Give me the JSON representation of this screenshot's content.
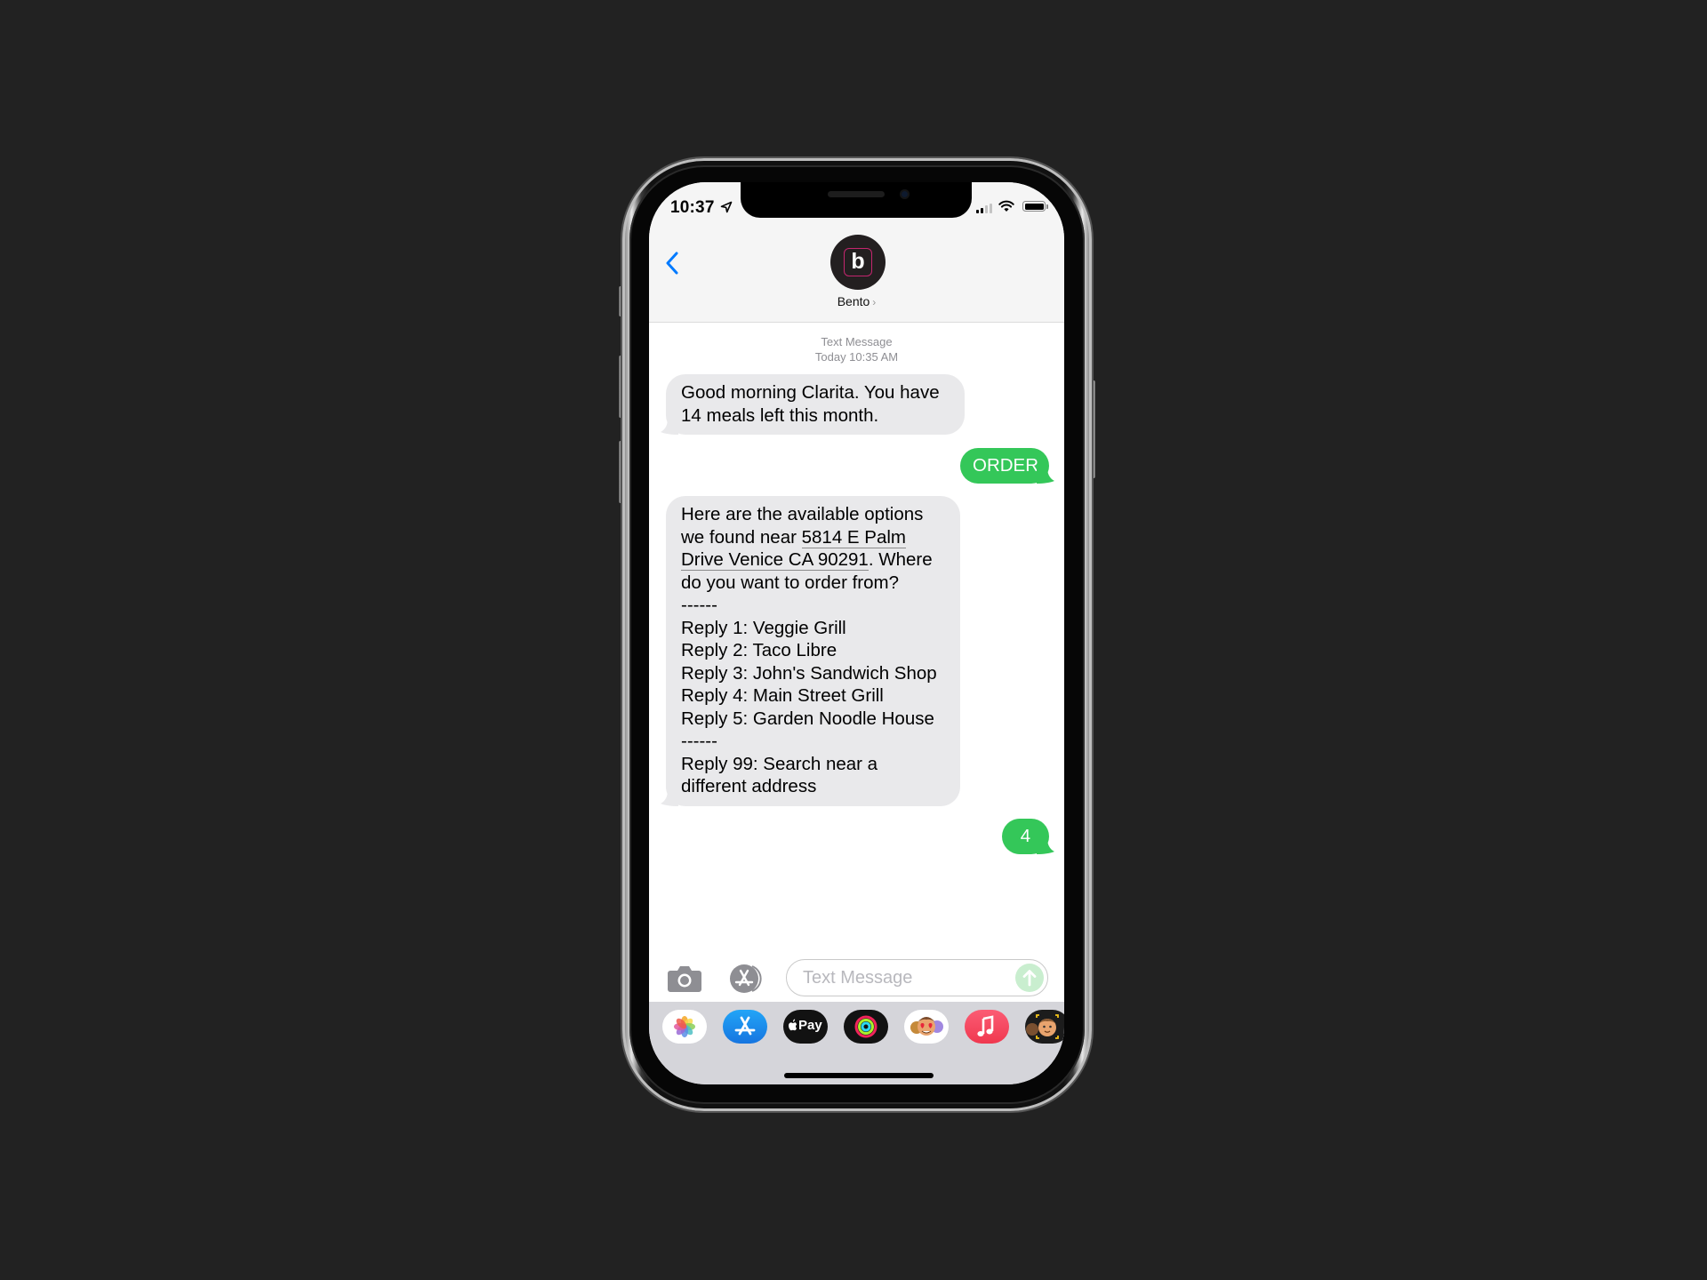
{
  "status_bar": {
    "time": "10:37",
    "location_icon": "location-arrow-icon",
    "signal_bars": 2,
    "signal_max": 4,
    "wifi_icon": "wifi-icon",
    "battery_level_pct": 100
  },
  "header": {
    "back_icon": "chevron-left-icon",
    "avatar_letter": "b",
    "contact_name": "Bento",
    "contact_chevron": "›",
    "accent_color": "#007aff",
    "avatar_border_color": "#c4266e"
  },
  "conversation": {
    "meta_type": "Text Message",
    "meta_time": "Today 10:35 AM",
    "messages": [
      {
        "direction": "incoming",
        "lines": [
          "Good morning Clarita. You have",
          "14 meals left this month."
        ]
      },
      {
        "direction": "outgoing",
        "text": "ORDER"
      },
      {
        "direction": "incoming",
        "intro_a": "Here are the available options",
        "intro_b": "we found near ",
        "address_part1": "5814 E Palm",
        "address_part2": "Drive Venice CA 90291",
        "intro_c": ". Where",
        "intro_d": "do you want to order from?",
        "divider": "------",
        "options": [
          "Reply 1: Veggie Grill",
          "Reply 2: Taco Libre",
          "Reply 3: John's Sandwich Shop",
          "Reply 4: Main Street Grill",
          "Reply 5: Garden Noodle House"
        ],
        "divider2": "------",
        "footer_lines": [
          "Reply 99: Search near a",
          "different address"
        ]
      },
      {
        "direction": "outgoing",
        "text": "4"
      }
    ],
    "incoming_color": "#e9e9eb",
    "outgoing_color": "#34c759"
  },
  "composer": {
    "camera_icon": "camera-icon",
    "app_store_icon": "app-store-icon",
    "placeholder": "Text Message",
    "value": "",
    "send_icon": "arrow-up-icon"
  },
  "app_tray": {
    "items": [
      {
        "name": "photos",
        "icon": "photos-icon"
      },
      {
        "name": "app-store",
        "icon": "app-store-icon"
      },
      {
        "name": "apple-pay",
        "icon": "apple-pay-icon",
        "label": "Pay"
      },
      {
        "name": "activity",
        "icon": "activity-rings-icon"
      },
      {
        "name": "animoji-stickers",
        "icon": "memoji-stickers-icon"
      },
      {
        "name": "music",
        "icon": "music-note-icon"
      },
      {
        "name": "memoji",
        "icon": "memoji-icon"
      }
    ]
  }
}
